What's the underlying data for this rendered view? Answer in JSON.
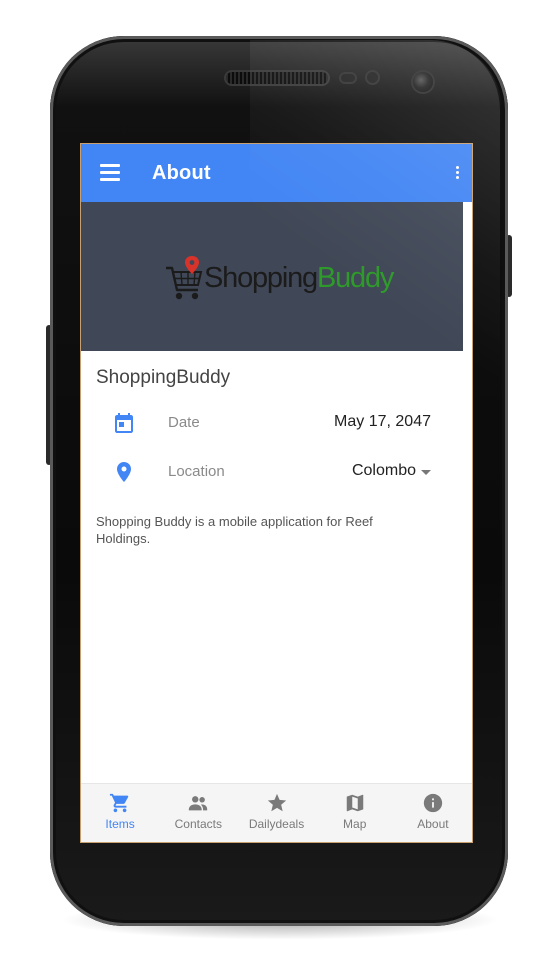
{
  "app_bar": {
    "title": "About",
    "menu_icon": "menu-icon",
    "overflow_icon": "more-vert-icon",
    "color": "#4285f4"
  },
  "banner": {
    "logo_word1": "Shopping",
    "logo_word2": "Buddy",
    "logo_icon": "shopping-cart-pin-icon",
    "background": "#404756"
  },
  "item": {
    "title": "ShoppingBuddy",
    "date_label": "Date",
    "date_value": "May 17, 2047",
    "date_icon": "calendar-icon",
    "location_label": "Location",
    "location_value": "Colombo",
    "location_icon": "location-pin-icon",
    "description": "Shopping Buddy is a mobile application for Reef Holdings."
  },
  "bottom_nav": {
    "items": [
      {
        "label": "Items",
        "icon": "cart-icon",
        "active": true
      },
      {
        "label": "Contacts",
        "icon": "contacts-icon",
        "active": false
      },
      {
        "label": "Dailydeals",
        "icon": "star-icon",
        "active": false
      },
      {
        "label": "Map",
        "icon": "map-icon",
        "active": false
      },
      {
        "label": "About",
        "icon": "info-icon",
        "active": false
      }
    ],
    "active_color": "#4285f4",
    "inactive_color": "#7a7a7a"
  }
}
